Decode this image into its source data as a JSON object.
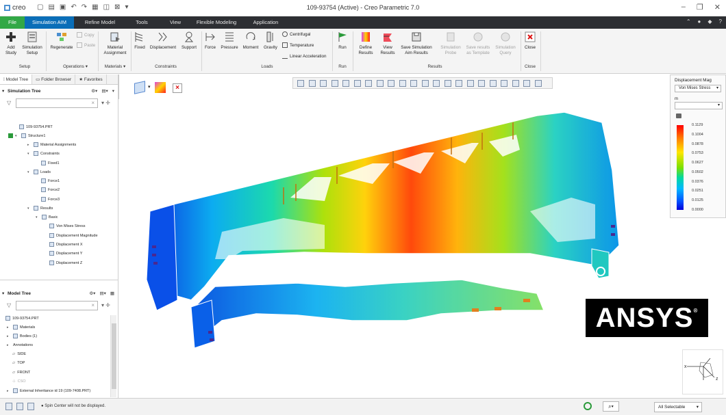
{
  "title_bar": {
    "app_name": "creo",
    "window_title": "109-93754 (Active) - Creo Parametric 7.0"
  },
  "ribbon_tabs": [
    "File",
    "Simulation AIM",
    "Refine Model",
    "Tools",
    "View",
    "Flexible Modeling",
    "Application"
  ],
  "ribbon": {
    "add_study": "Add Study",
    "simulation_setup": "Simulation Setup",
    "regenerate": "Regenerate",
    "copy": "Copy",
    "paste": "Paste",
    "material_assignment": "Material Assignment",
    "fixed": "Fixed",
    "displacement": "Displacement",
    "support": "Support",
    "force": "Force",
    "pressure": "Pressure",
    "moment": "Moment",
    "gravity": "Gravity",
    "centrifugal": "Centrifugal",
    "temperature": "Temperature",
    "linear_acceleration": "Linear Acceleration",
    "run": "Run",
    "define_results": "Define Results",
    "view_results": "View Results",
    "save_simulation_aim_results": "Save Simulation Aim Results",
    "simulation_probe": "Simulation Probe",
    "save_results_as_template": "Save results as Template",
    "simulation_query": "Simulation Query",
    "close": "Close",
    "groups": {
      "setup": "Setup",
      "operations": "Operations ▾",
      "materials": "Materials ▾",
      "constraints": "Constraints",
      "loads": "Loads",
      "run": "Run",
      "results": "Results",
      "close": "Close"
    }
  },
  "left_panel": {
    "tabs": [
      "Model Tree",
      "Folder Browser",
      "Favorites"
    ],
    "simulation_tree": {
      "header": "Simulation Tree",
      "nodes": [
        "109-93754.PRT",
        "Structure1",
        "Material Assignments",
        "Constraints",
        "Fixed1",
        "Loads",
        "Force1",
        "Force2",
        "Force3",
        "Results",
        "Basic",
        "Von Mises Stress",
        "Displacement Magnitude",
        "Displacement X",
        "Displacement Y",
        "Displacement Z"
      ]
    },
    "model_tree": {
      "header": "Model Tree",
      "nodes": [
        "109-93754.PRT",
        "Materials",
        "Bodies (1)",
        "Annotations",
        "SIDE",
        "TOP",
        "FRONT",
        "CSO",
        "External Inheritance id 19 (109-7408.PRT)"
      ]
    }
  },
  "legend": {
    "title": "Displacement Mag",
    "result_select": "Von Mises Stress",
    "unit": "m",
    "ticks": [
      "0.1129",
      "0.1004",
      "0.0878",
      "0.0753",
      "0.0627",
      "0.0502",
      "0.0376",
      "0.0251",
      "0.0125",
      "0.0000"
    ]
  },
  "logo": {
    "brand": "ANSYS"
  },
  "status_bar": {
    "message": "Spin Center will not be displayed.",
    "selection_filter": "All Selectable"
  },
  "colors": {
    "file_tab": "#32a846",
    "active_tab": "#0a6eb8",
    "tab_bar": "#2d2f33",
    "high_displacement": "#ff0000",
    "low_displacement": "#0000d8"
  },
  "icons": {
    "graphics_toolbar": [
      "refit-icon",
      "zoom-in-icon",
      "zoom-out-icon",
      "repaint-icon",
      "spin-center-icon",
      "named-view-icon",
      "display-style-icon",
      "view-manager-icon",
      "perspective-icon",
      "datum-display-icon",
      "annotation-display-icon",
      "saved-orientations-icon",
      "section-icon",
      "hidden-line-icon",
      "shading-icon",
      "edges-icon",
      "mesh-icon",
      "fringe-icon",
      "deformation-icon",
      "animation-icon",
      "probe-icon",
      "legend-icon"
    ]
  }
}
